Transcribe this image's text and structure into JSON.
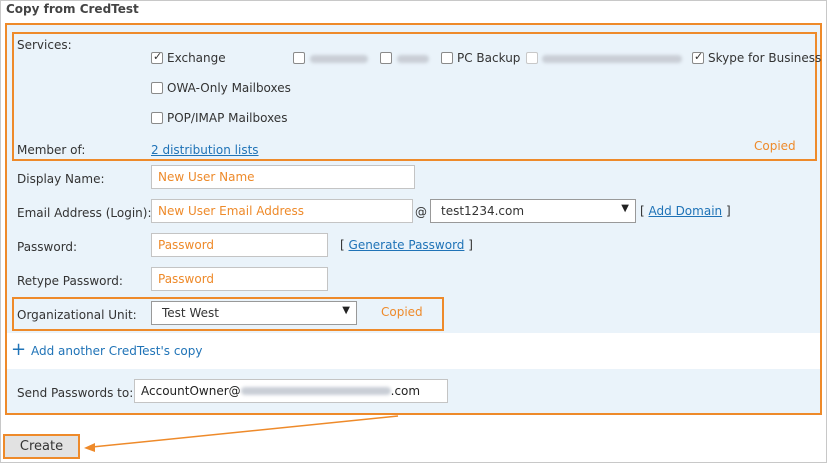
{
  "title": "Copy from CredTest",
  "services": {
    "label": "Services:",
    "items": [
      {
        "label": "Exchange",
        "checked": true
      },
      {
        "label": "",
        "checked": false,
        "blurred": true
      },
      {
        "label": "",
        "checked": false,
        "blurred": true
      },
      {
        "label": "PC Backup",
        "checked": false
      },
      {
        "label": "",
        "checked": false,
        "blurred": true,
        "disabled": true
      },
      {
        "label": "Skype for Business",
        "checked": true
      },
      {
        "label": "OWA-Only Mailboxes",
        "checked": false
      },
      {
        "label": "POP/IMAP Mailboxes",
        "checked": false
      }
    ]
  },
  "member_of": {
    "label": "Member of:",
    "link": "2 distribution lists"
  },
  "copied_label": "Copied",
  "display_name": {
    "label": "Display Name:",
    "placeholder": "New User Name"
  },
  "email": {
    "label": "Email Address (Login):",
    "placeholder": "New User Email Address",
    "at": "@",
    "domain": "test1234.com",
    "add_domain_open": "[",
    "add_domain": "Add Domain",
    "add_domain_close": "]"
  },
  "password": {
    "label": "Password:",
    "placeholder": "Password",
    "gen_open": "[",
    "generate": "Generate Password",
    "gen_close": "]"
  },
  "retype": {
    "label": "Retype Password:",
    "placeholder": "Password"
  },
  "ou": {
    "label": "Organizational Unit:",
    "value": "Test West"
  },
  "add_copy": "Add another CredTest's copy",
  "send": {
    "label": "Send Passwords to:",
    "value_prefix": "AccountOwner@",
    "value_suffix": ".com"
  },
  "create_button": "Create"
}
